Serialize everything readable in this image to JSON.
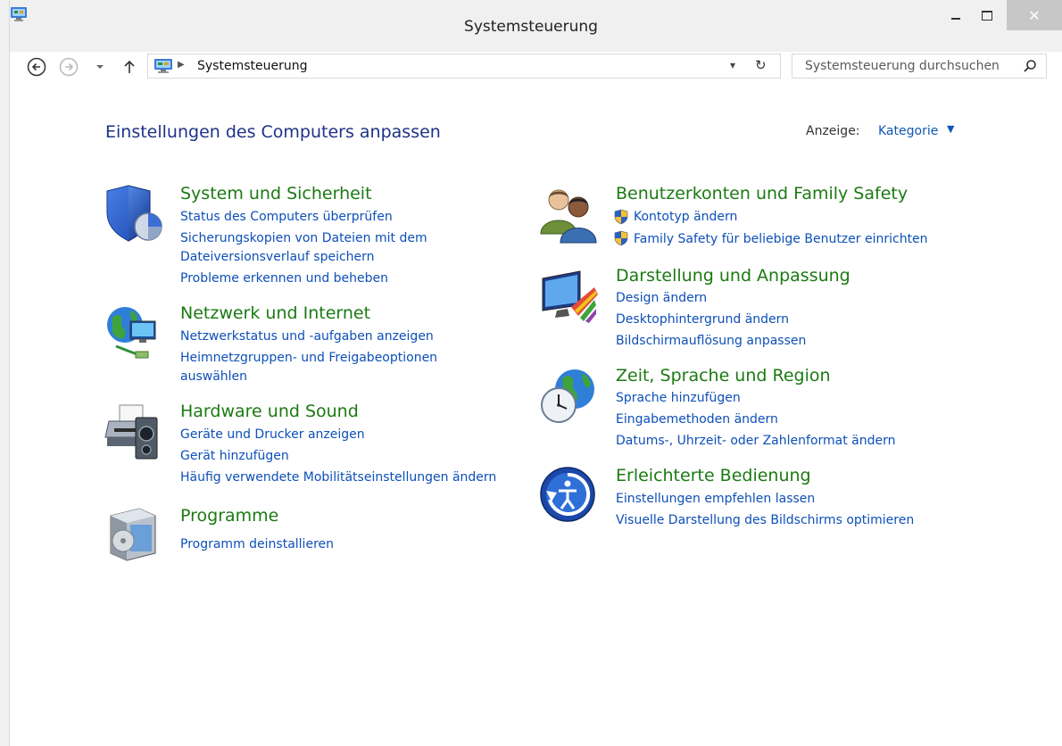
{
  "window": {
    "title": "Systemsteuerung",
    "close_glyph": "✕"
  },
  "nav": {
    "breadcrumb": "Systemsteuerung",
    "search_placeholder": "Systemsteuerung durchsuchen"
  },
  "header": {
    "title": "Einstellungen des Computers anpassen",
    "view_label": "Anzeige:",
    "view_value": "Kategorie"
  },
  "categories": {
    "system": {
      "title": "System und Sicherheit",
      "links": [
        "Status des Computers überprüfen",
        "Sicherungskopien von Dateien mit dem",
        "Dateiversionsverlauf speichern",
        "Probleme erkennen und beheben"
      ]
    },
    "network": {
      "title": "Netzwerk und Internet",
      "links": [
        "Netzwerkstatus und -aufgaben anzeigen",
        "Heimnetzgruppen- und Freigabeoptionen",
        "auswählen"
      ]
    },
    "hardware": {
      "title": "Hardware und Sound",
      "links": [
        "Geräte und Drucker anzeigen",
        "Gerät hinzufügen",
        "Häufig verwendete Mobilitätseinstellungen ändern"
      ]
    },
    "programs": {
      "title": "Programme",
      "links": [
        "Programm deinstallieren"
      ]
    },
    "users": {
      "title": "Benutzerkonten und Family Safety",
      "links": [
        "Kontotyp ändern",
        "Family Safety für beliebige Benutzer einrichten"
      ]
    },
    "appearance": {
      "title": "Darstellung und Anpassung",
      "links": [
        "Design ändern",
        "Desktophintergrund ändern",
        "Bildschirmauflösung anpassen"
      ]
    },
    "clock": {
      "title": "Zeit, Sprache und Region",
      "links": [
        "Sprache hinzufügen",
        "Eingabemethoden ändern",
        "Datums-, Uhrzeit- oder Zahlenformat ändern"
      ]
    },
    "ease": {
      "title": "Erleichterte Bedienung",
      "links": [
        "Einstellungen empfehlen lassen",
        "Visuelle Darstellung des Bildschirms optimieren"
      ]
    }
  },
  "colors": {
    "category_title": "#1b7a12",
    "link": "#0d4fb8",
    "heading": "#1e3287"
  }
}
